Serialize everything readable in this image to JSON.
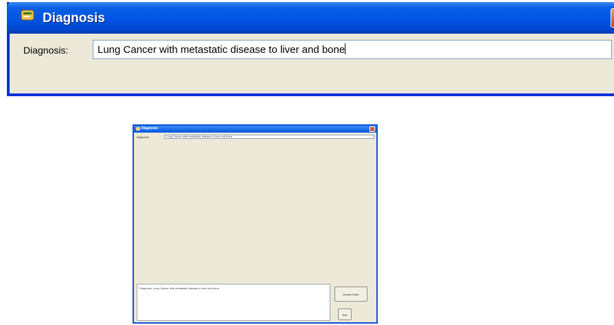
{
  "window": {
    "title": "Diagnosis",
    "icon": "app-icon",
    "close_icon": "close-icon",
    "diagnosis_label": "Diagnosis:",
    "diagnosis_value": "Lung Cancer with metastatic disease to liver and bone"
  },
  "thumbnail": {
    "title": "Diagnosis",
    "diagnosis_label": "Diagnosis:",
    "diagnosis_value": "Lung Cancer with metastatic disease to liver and bone",
    "bottom_text": "Diagnosis:    Lung Cancer with metastatic disease to liver and bone",
    "accept_button": "Accept Order",
    "exit_button": "Exit"
  },
  "colors": {
    "titlebar": "#0054e3",
    "window_face": "#ece9d8",
    "close_button": "#c4411a"
  }
}
